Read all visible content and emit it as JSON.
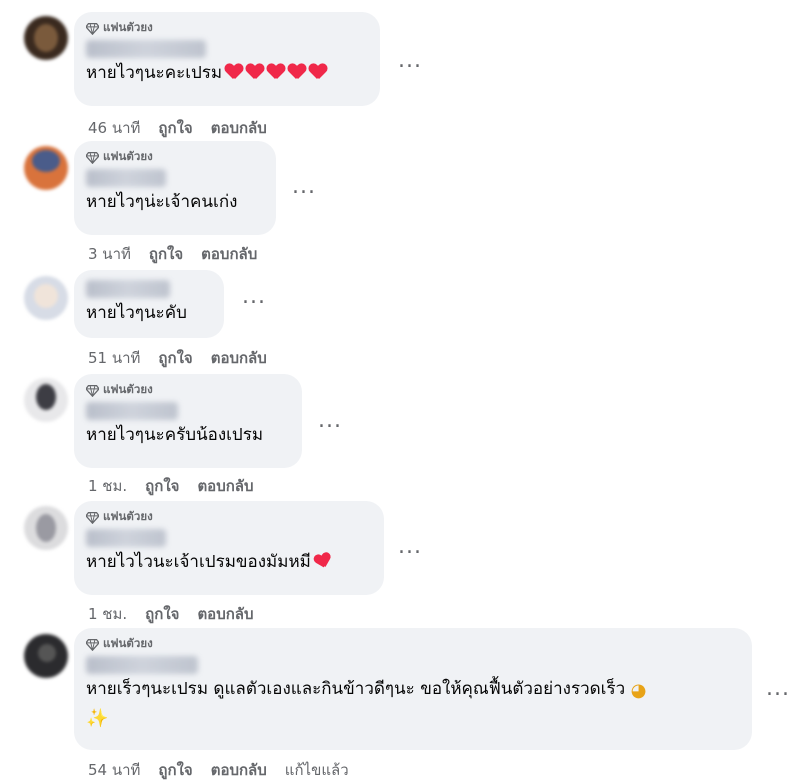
{
  "badge_label": "แฟนตัวยง",
  "more_label": "...",
  "like_label": "ถูกใจ",
  "reply_label": "ตอบกลับ",
  "comments": [
    {
      "has_badge": true,
      "text": "หายไวๆนะคะเปรม",
      "time": "46 นาที",
      "emoji": "hearts",
      "hearts": 5
    },
    {
      "has_badge": true,
      "text": "หายไวๆน่ะเจ้าคนเก่ง",
      "time": "3 นาที"
    },
    {
      "has_badge": false,
      "text": "หายไวๆนะคับ",
      "time": "51 นาที"
    },
    {
      "has_badge": true,
      "text": "หายไวๆนะครับน้องเปรม",
      "time": "1 ชม."
    },
    {
      "has_badge": true,
      "text": "หายไวไวนะเจ้าเปรมของมัมหมี",
      "time": "1 ชม.",
      "emoji": "two-hearts"
    },
    {
      "has_badge": true,
      "text": "หายเร็วๆนะเปรม ดูแลตัวเองและกินข้าวดีๆนะ ขอให้คุณฟื้นตัวอย่างรวดเร็ว",
      "time": "54 นาที",
      "edited": "แก้ไขแล้ว",
      "emoji": "pleading-sparkles"
    }
  ]
}
